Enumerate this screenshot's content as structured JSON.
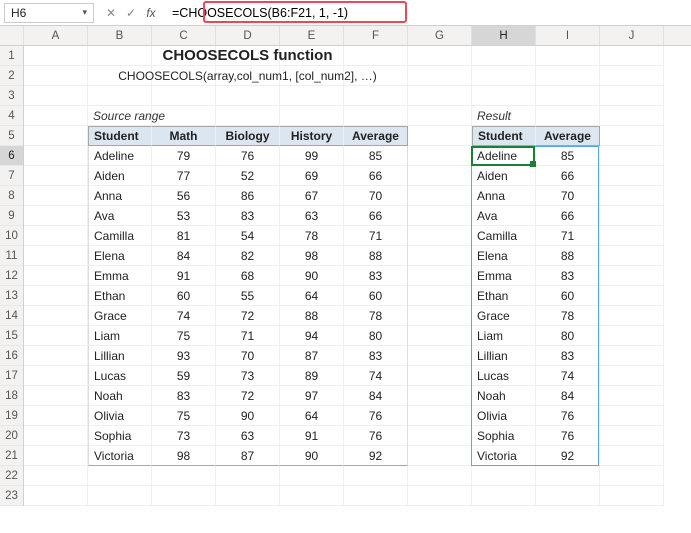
{
  "formula_bar": {
    "cell_ref": "H6",
    "formula": "=CHOOSECOLS(B6:F21, 1, -1)"
  },
  "columns": [
    "A",
    "B",
    "C",
    "D",
    "E",
    "F",
    "G",
    "H",
    "I",
    "J"
  ],
  "selected_col": "H",
  "selected_row": "6",
  "titles": {
    "main": "CHOOSECOLS function",
    "sub": "CHOOSECOLS(array,col_num1, [col_num2], …)"
  },
  "labels": {
    "source": "Source range",
    "result": "Result"
  },
  "source_headers": [
    "Student",
    "Math",
    "Biology",
    "History",
    "Average"
  ],
  "result_headers": [
    "Student",
    "Average"
  ],
  "rows": [
    {
      "student": "Adeline",
      "math": 79,
      "bio": 76,
      "hist": 99,
      "avg": 85
    },
    {
      "student": "Aiden",
      "math": 77,
      "bio": 52,
      "hist": 69,
      "avg": 66
    },
    {
      "student": "Anna",
      "math": 56,
      "bio": 86,
      "hist": 67,
      "avg": 70
    },
    {
      "student": "Ava",
      "math": 53,
      "bio": 83,
      "hist": 63,
      "avg": 66
    },
    {
      "student": "Camilla",
      "math": 81,
      "bio": 54,
      "hist": 78,
      "avg": 71
    },
    {
      "student": "Elena",
      "math": 84,
      "bio": 82,
      "hist": 98,
      "avg": 88
    },
    {
      "student": "Emma",
      "math": 91,
      "bio": 68,
      "hist": 90,
      "avg": 83
    },
    {
      "student": "Ethan",
      "math": 60,
      "bio": 55,
      "hist": 64,
      "avg": 60
    },
    {
      "student": "Grace",
      "math": 74,
      "bio": 72,
      "hist": 88,
      "avg": 78
    },
    {
      "student": "Liam",
      "math": 75,
      "bio": 71,
      "hist": 94,
      "avg": 80
    },
    {
      "student": "Lillian",
      "math": 93,
      "bio": 70,
      "hist": 87,
      "avg": 83
    },
    {
      "student": "Lucas",
      "math": 59,
      "bio": 73,
      "hist": 89,
      "avg": 74
    },
    {
      "student": "Noah",
      "math": 83,
      "bio": 72,
      "hist": 97,
      "avg": 84
    },
    {
      "student": "Olivia",
      "math": 75,
      "bio": 90,
      "hist": 64,
      "avg": 76
    },
    {
      "student": "Sophia",
      "math": 73,
      "bio": 63,
      "hist": 91,
      "avg": 76
    },
    {
      "student": "Victoria",
      "math": 98,
      "bio": 87,
      "hist": 90,
      "avg": 92
    }
  ],
  "chart_data": {
    "type": "table",
    "title": "CHOOSECOLS function",
    "columns": [
      "Student",
      "Math",
      "Biology",
      "History",
      "Average"
    ],
    "data": [
      [
        "Adeline",
        79,
        76,
        99,
        85
      ],
      [
        "Aiden",
        77,
        52,
        69,
        66
      ],
      [
        "Anna",
        56,
        86,
        67,
        70
      ],
      [
        "Ava",
        53,
        83,
        63,
        66
      ],
      [
        "Camilla",
        81,
        54,
        78,
        71
      ],
      [
        "Elena",
        84,
        82,
        98,
        88
      ],
      [
        "Emma",
        91,
        68,
        90,
        83
      ],
      [
        "Ethan",
        60,
        55,
        64,
        60
      ],
      [
        "Grace",
        74,
        72,
        88,
        78
      ],
      [
        "Liam",
        75,
        71,
        94,
        80
      ],
      [
        "Lillian",
        93,
        70,
        87,
        83
      ],
      [
        "Lucas",
        59,
        73,
        89,
        74
      ],
      [
        "Noah",
        83,
        72,
        97,
        84
      ],
      [
        "Olivia",
        75,
        90,
        64,
        76
      ],
      [
        "Sophia",
        73,
        63,
        91,
        76
      ],
      [
        "Victoria",
        98,
        87,
        90,
        92
      ]
    ]
  }
}
